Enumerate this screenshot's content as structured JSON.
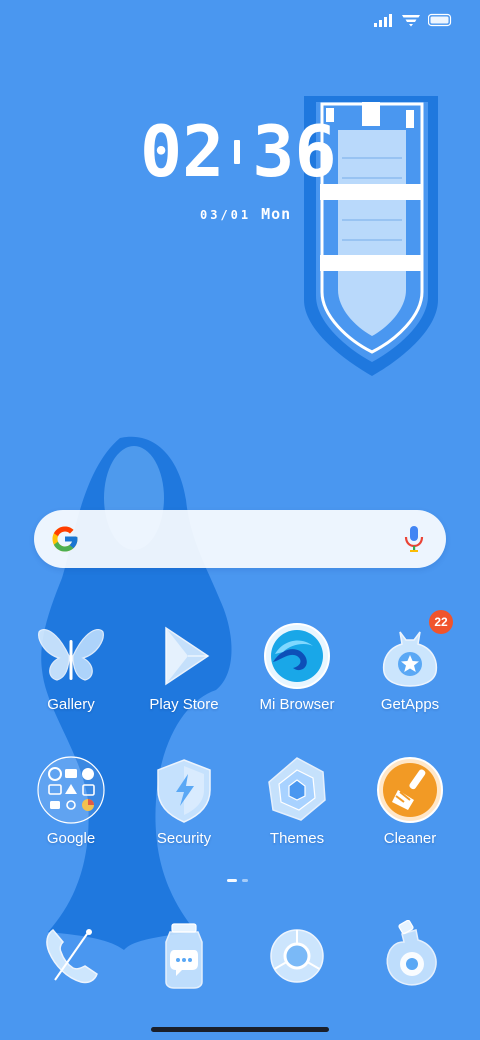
{
  "clock": {
    "hours": "02",
    "minutes": "36"
  },
  "date": {
    "date": "03/01",
    "day": "Mon"
  },
  "status_bar": {
    "signal_icon": "signal-icon",
    "wifi_icon": "wifi-icon",
    "battery_icon": "battery-icon"
  },
  "search": {
    "logo_icon": "google-g-icon",
    "mic_icon": "microphone-icon"
  },
  "apps": [
    {
      "label": "Gallery",
      "icon": "butterfly-icon"
    },
    {
      "label": "Play Store",
      "icon": "play-triangle-icon"
    },
    {
      "label": "Mi Browser",
      "icon": "wave-globe-icon"
    },
    {
      "label": "GetApps",
      "icon": "star-bag-icon",
      "badge": "22"
    },
    {
      "label": "Google",
      "icon": "google-folder-icon"
    },
    {
      "label": "Security",
      "icon": "shield-bolt-icon"
    },
    {
      "label": "Themes",
      "icon": "spiral-crystal-icon"
    },
    {
      "label": "Cleaner",
      "icon": "broom-icon"
    }
  ],
  "dock": [
    {
      "icon": "phone-icon"
    },
    {
      "icon": "messages-jar-icon"
    },
    {
      "icon": "chrome-icon"
    },
    {
      "icon": "camera-bottle-icon"
    }
  ],
  "pager": {
    "pages": 2,
    "current": 1
  },
  "colors": {
    "background": "#4a97f0",
    "whale": "#1f78de",
    "badge": "#f0542c"
  }
}
